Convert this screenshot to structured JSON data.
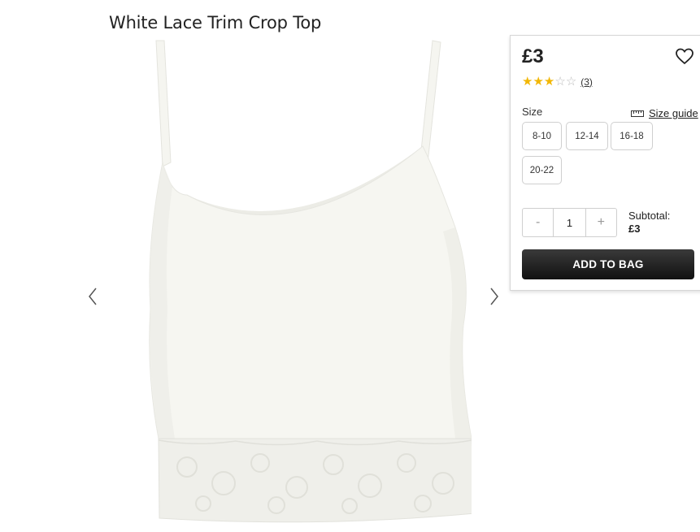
{
  "product": {
    "title": "White Lace Trim Crop Top",
    "image_icon": "crop-top-image"
  },
  "gallery": {
    "prev_icon": "chevron-left-icon",
    "next_icon": "chevron-right-icon"
  },
  "purchase_panel": {
    "price": "£3",
    "wishlist_icon": "heart-icon",
    "rating": {
      "value": 3,
      "max": 5,
      "count_label": "(3)"
    },
    "size_label": "Size",
    "size_guide_label": "Size guide",
    "size_guide_icon": "ruler-icon",
    "sizes": [
      "8-10",
      "12-14",
      "16-18",
      "20-22"
    ],
    "quantity": {
      "minus_label": "-",
      "value": "1",
      "plus_label": "+"
    },
    "subtotal_label": "Subtotal:",
    "subtotal_value": "£3",
    "add_to_bag_label": "ADD TO BAG"
  },
  "colors": {
    "star": "#f2b705",
    "button_dark": "#1a1a1a"
  }
}
